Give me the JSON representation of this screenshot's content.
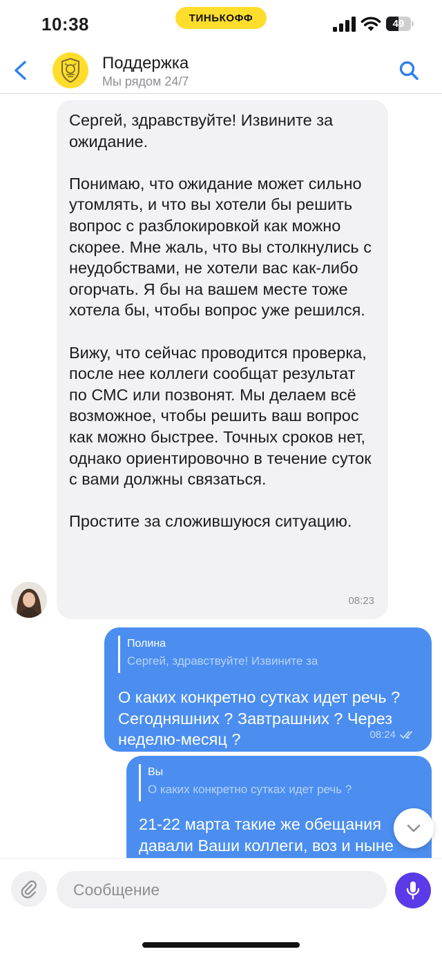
{
  "status_bar": {
    "time": "10:38",
    "carrier_label": "ТИНЬКОФФ",
    "battery_level": "49",
    "battery_fraction": 0.49,
    "icons": [
      "signal-icon",
      "wifi-icon",
      "battery-icon"
    ]
  },
  "header": {
    "title": "Поддержка",
    "subtitle": "Мы рядом 24/7",
    "icons": [
      "back-icon",
      "tinkoff-logo",
      "search-icon"
    ]
  },
  "messages": {
    "incoming": {
      "paragraphs": [
        "Сергей, здравствуйте! Извините за ожидание.",
        "Понимаю, что ожидание может сильно утомлять, и что вы хотели бы решить вопрос с разблокировкой как можно скорее. Мне жаль, что вы столкнулись с неудобствами, не хотели вас как-либо огорчать. Я бы на вашем месте тоже хотела бы, чтобы вопрос уже решился.",
        "Вижу, что сейчас проводится проверка, после нее коллеги сообщат результат по СМС или позвонят. Мы делаем всё возможное, чтобы решить ваш вопрос как можно быстрее. Точных сроков нет, однако ориентировочно в течение суток с вами должны связаться.",
        "Простите за сложившуюся ситуацию."
      ],
      "time": "08:23"
    },
    "outgoing_1": {
      "reply_name": "Полина",
      "reply_text": "Сергей, здравствуйте! Извините за",
      "text": "О каких конкретно сутках идет речь ? Сегодняшних ? Завтрашних ? Через неделю-месяц ?",
      "time": "08:24",
      "status_icon": "double-check-icon"
    },
    "outgoing_2": {
      "reply_name": "Вы",
      "reply_text": "О каких конкретно сутках идет речь ?",
      "line1": "21-22 марта такие же обещания",
      "line2": "давали Ваши коллеги, воз и ныне"
    }
  },
  "input_bar": {
    "placeholder": "Сообщение",
    "icons": [
      "paperclip-icon",
      "microphone-icon",
      "chevron-down-icon"
    ]
  },
  "colors": {
    "brand_yellow": "#ffdd2d",
    "outgoing_bubble": "#4b8ef0",
    "incoming_bubble": "#f2f2f4",
    "accent_blue": "#2f80ed",
    "mic_purple": "#5b3ae8"
  }
}
